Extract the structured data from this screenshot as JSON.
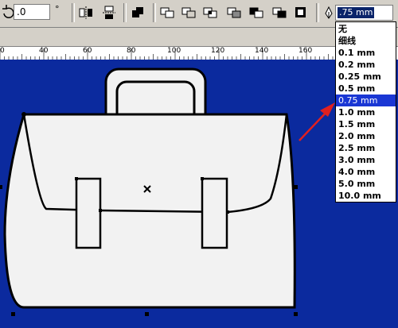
{
  "toolbar": {
    "angle_value": ".0",
    "angle_unit": "°",
    "outline_width_value": ".75 mm"
  },
  "ruler": {
    "labels": [
      "0",
      "40",
      "60",
      "80",
      "100",
      "120",
      "140",
      "160"
    ]
  },
  "outline_dropdown": {
    "items": [
      "无",
      "细线",
      "0.1 mm",
      "0.2 mm",
      "0.25 mm",
      "0.5 mm",
      "0.75 mm",
      "1.0 mm",
      "1.5 mm",
      "2.0 mm",
      "2.5 mm",
      "3.0 mm",
      "4.0 mm",
      "5.0 mm",
      "10.0 mm"
    ],
    "selected_index": 6
  },
  "colors": {
    "canvas_bg": "#0b2a9e",
    "toolbar_bg": "#d4d0c8",
    "selection_highlight": "#1a37d4",
    "annotation_arrow": "#e02020"
  }
}
